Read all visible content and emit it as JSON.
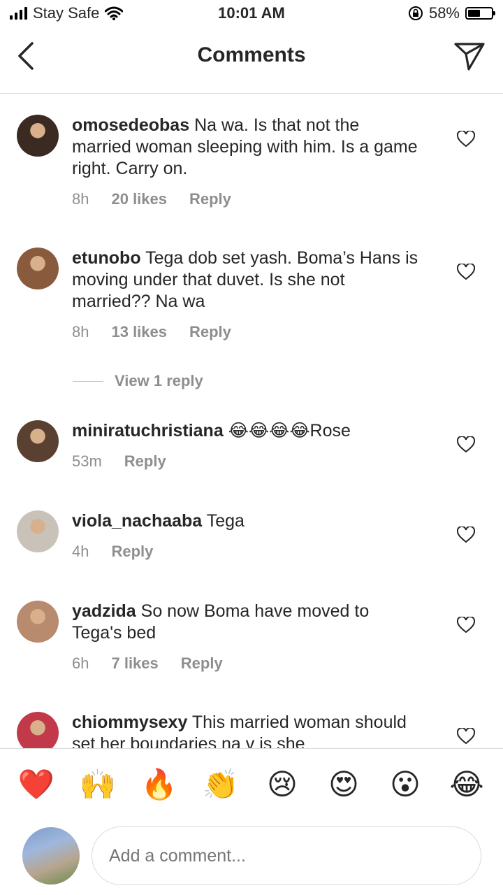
{
  "status_bar": {
    "carrier": "Stay Safe",
    "time": "10:01 AM",
    "battery": "58%",
    "battery_level": 0.58
  },
  "header": {
    "title": "Comments"
  },
  "comments": [
    {
      "username": "omosedeobas",
      "text": "Na wa. Is that not the married woman sleeping with him. Is a game right. Carry on.",
      "time": "8h",
      "likes": "20 likes",
      "reply": "Reply",
      "avatar_color": "#3b2a22"
    },
    {
      "username": "etunobo",
      "text": "Tega dob set yash. Boma’s Hans is moving under that duvet. Is she not married?? Na wa",
      "time": "8h",
      "likes": "13 likes",
      "reply": "Reply",
      "avatar_color": "#8a5a3c"
    },
    {
      "username": "miniratuchristiana",
      "text": "😂😂😂😂Rose",
      "time": "53m",
      "reply": "Reply",
      "avatar_color": "#5a4030"
    },
    {
      "username": "viola_nachaaba",
      "text": "Tega",
      "time": "4h",
      "reply": "Reply",
      "avatar_color": "#c9c2b8"
    },
    {
      "username": "yadzida",
      "text": "So now Boma have moved to Tega's bed",
      "time": "6h",
      "likes": "7 likes",
      "reply": "Reply",
      "avatar_color": "#b88a6e"
    },
    {
      "username": "chiommysexy",
      "text": "This married woman should set her boundaries na v is she",
      "avatar_color": "#c23a4a"
    }
  ],
  "view_replies": "View 1 reply",
  "emoji_bar": [
    "❤️",
    "🙌",
    "🔥",
    "👏",
    "😢",
    "😍",
    "😮",
    "😂"
  ],
  "input": {
    "placeholder": "Add a comment..."
  }
}
